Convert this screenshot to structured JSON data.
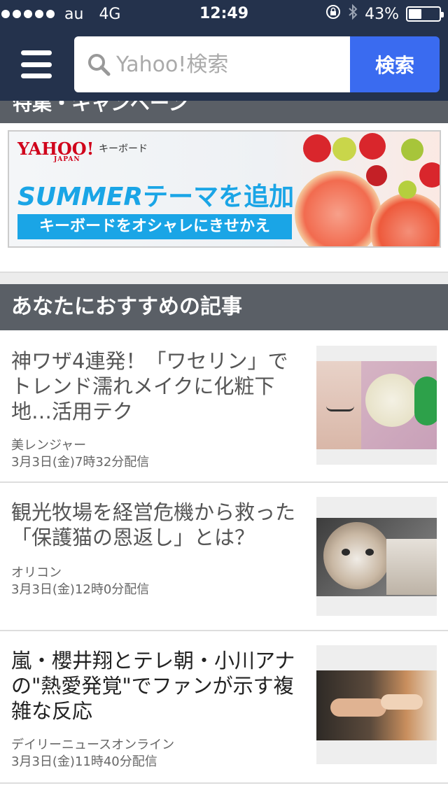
{
  "status_bar": {
    "carrier": "au",
    "network": "4G",
    "time": "12:49",
    "battery": "43%",
    "battery_level": 0.43
  },
  "header": {
    "search_placeholder": "Yahoo!検索",
    "search_button": "検索"
  },
  "peek_section_title": "特集・キャンペーン",
  "banner": {
    "logo_text": "YAHOO!",
    "logo_sub": "JAPAN",
    "keyboard_label": "キーボード",
    "headline_en": "SUMMER",
    "headline_jp": "テーマを追加",
    "tagline": "キーボードをオシャレにきせかえ"
  },
  "recommend": {
    "section_title": "あなたにおすすめの記事",
    "articles": [
      {
        "title": "神ワザ4連発！「ワセリン」でトレンド濡れメイクに化粧下地…活用テク",
        "source": "美レンジャー",
        "date": "3月3日(金)7時32分配信"
      },
      {
        "title": "観光牧場を経営危機から救った「保護猫の恩返し」とは？",
        "source": "オリコン",
        "date": "3月3日(金)12時0分配信"
      },
      {
        "title": "嵐・櫻井翔とテレ朝・小川アナの\"熱愛発覚\"でファンが示す複雑な反応",
        "source": "デイリーニュースオンライン",
        "date": "3月3日(金)11時40分配信"
      }
    ]
  }
}
